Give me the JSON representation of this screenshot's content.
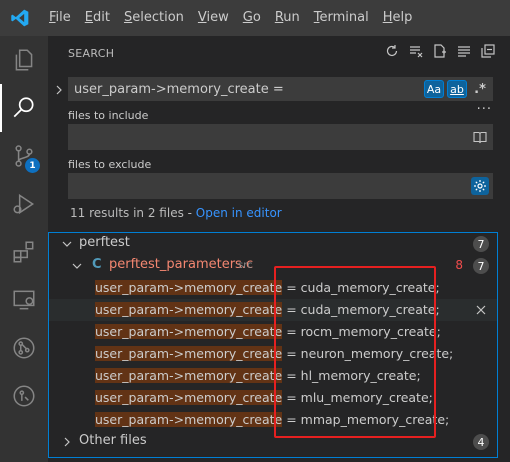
{
  "menubar": {
    "items": [
      "File",
      "Edit",
      "Selection",
      "View",
      "Go",
      "Run",
      "Terminal",
      "Help"
    ],
    "mnemonics": [
      "F",
      "E",
      "S",
      "V",
      "G",
      "R",
      "T",
      "H"
    ]
  },
  "activitybar": {
    "items": [
      {
        "icon": "explorer-icon"
      },
      {
        "icon": "search-icon",
        "active": true
      },
      {
        "icon": "source-control-icon",
        "badge": "1"
      },
      {
        "icon": "run-debug-icon"
      },
      {
        "icon": "extensions-icon"
      },
      {
        "icon": "remote-explorer-icon"
      },
      {
        "icon": "git-pull-request-icon"
      },
      {
        "icon": "gitlens-icon"
      }
    ]
  },
  "sidebar": {
    "title": "SEARCH",
    "search": {
      "value": "user_param->memory_create =",
      "match_case_label": "Aa",
      "whole_word_label": "ab",
      "regex_label": ".*"
    },
    "more_dots": "···",
    "include_label": "files to include",
    "exclude_label": "files to exclude",
    "results_message": "11 results in 2 files - ",
    "open_in_editor": "Open in editor"
  },
  "tree": {
    "folder": {
      "label": "perftest",
      "count": "7"
    },
    "file": {
      "icon": "C",
      "label": "perftest_parameters.c",
      "path": "src",
      "problems": "8",
      "count": "7"
    },
    "match_prefix": "user_param->memory_create",
    "matches": [
      " = cuda_memory_create;",
      " = cuda_memory_create;",
      " = rocm_memory_create;",
      " = neuron_memory_create;",
      " = hl_memory_create;",
      " = mlu_memory_create;",
      " = mmap_memory_create;"
    ],
    "other": {
      "label": "Other files",
      "count": "4"
    }
  },
  "colors": {
    "accent": "#007fd4",
    "match_highlight": "#623315",
    "annotation": "#e62020"
  }
}
